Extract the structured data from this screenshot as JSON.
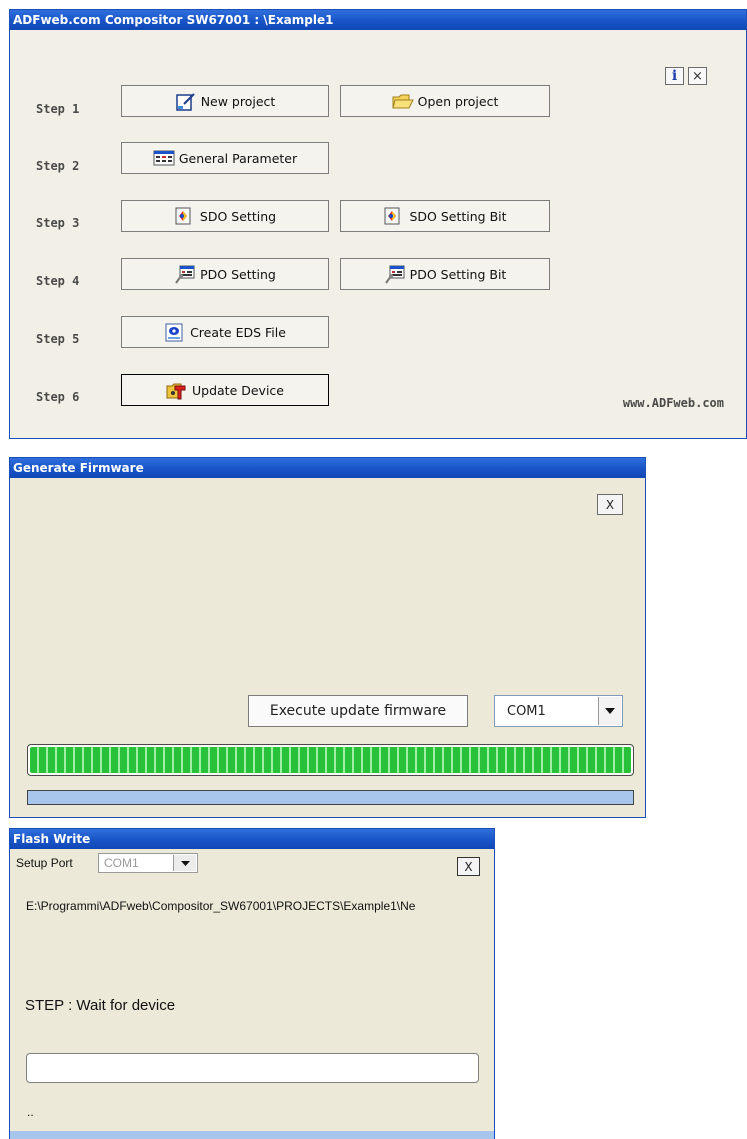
{
  "compositor": {
    "title": "ADFweb.com Compositor SW67001 : \\Example1",
    "steps": [
      {
        "label": "Step 1"
      },
      {
        "label": "Step 2"
      },
      {
        "label": "Step 3"
      },
      {
        "label": "Step 4"
      },
      {
        "label": "Step 5"
      },
      {
        "label": "Step 6"
      }
    ],
    "buttons": {
      "new_project": "New project",
      "open_project": "Open project",
      "general_parameter": "General Parameter",
      "sdo_setting": "SDO Setting",
      "sdo_setting_bit": "SDO Setting Bit",
      "pdo_setting": "PDO Setting",
      "pdo_setting_bit": "PDO Setting Bit",
      "create_eds": "Create EDS File",
      "update_device": "Update Device"
    },
    "info_label": "i",
    "close_label": "×",
    "website": "www.ADFweb.com"
  },
  "generate_firmware": {
    "title": "Generate Firmware",
    "close_label": "X",
    "execute_label": "Execute update firmware",
    "port_value": "COM1",
    "progress": 1.0
  },
  "flash_write": {
    "title": "Flash Write",
    "setup_port_label": "Setup Port",
    "port_value": "COM1",
    "close_label": "X",
    "path": "E:\\Programmi\\ADFweb\\Compositor_SW67001\\PROJECTS\\Example1\\Ne",
    "step_text": "STEP : Wait for device",
    "status_text": ".."
  },
  "colors": {
    "titlebar": "#1a56c9",
    "progress_green": "#27c23a",
    "progress_blue": "#a8c6ec"
  },
  "icons": [
    "new-project-icon",
    "open-folder-icon",
    "general-parameter-icon",
    "sdo-icon",
    "pdo-icon",
    "eds-file-icon",
    "update-device-icon",
    "info-icon",
    "close-icon",
    "dropdown-arrow-icon"
  ]
}
